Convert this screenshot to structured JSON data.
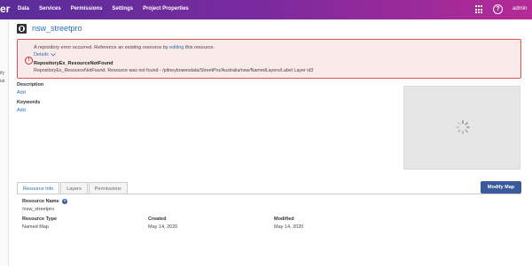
{
  "topbar": {
    "brand_tail": "er",
    "nav": [
      "Data",
      "Services",
      "Permissions",
      "Settings",
      "Project Properties"
    ],
    "user": "admin",
    "apps_icon": "grid-icon",
    "help_icon": "question-circle-icon",
    "help_glyph": "?"
  },
  "left_panel": {
    "frag1": "ify",
    "frag2": "iat"
  },
  "page": {
    "title": "nsw_streetpro",
    "title_icon": "globe-icon"
  },
  "alert": {
    "icon_glyph": "!",
    "message_pre": "A repository error occurred. Reference an existing resource by ",
    "message_link": "editing",
    "message_post": " this resource.",
    "details_label": "Details",
    "error_name": "RepositoryEx_ResourceNotFound",
    "error_detail": "RepositoryEx_ResourceNotFound: Resource was not found - /pitneybowesdata/StreetPro/Australia/nsw/NamedLayers/Label Layer id3"
  },
  "description": {
    "label": "Description",
    "add": "Add"
  },
  "keywords": {
    "label": "Keywords",
    "add": "Add"
  },
  "tabs": [
    "Resource Info",
    "Layers",
    "Permissions"
  ],
  "modify_button": "Modify Map",
  "resource": {
    "name_label": "Resource Name",
    "name_value": "/nsw_streetpro",
    "info_glyph": "?",
    "type_label": "Resource Type",
    "type_value": "Named Map",
    "created_label": "Created",
    "created_value": "May 14, 2020",
    "modified_label": "Modified",
    "modified_value": "May 14, 2020"
  },
  "colors": {
    "topbar_start": "#5a2d9a",
    "topbar_end": "#b52a96",
    "link": "#2a6db5",
    "alert_border": "#d9534f",
    "alert_bg": "#fbeaea",
    "button": "#3a5a9b"
  }
}
